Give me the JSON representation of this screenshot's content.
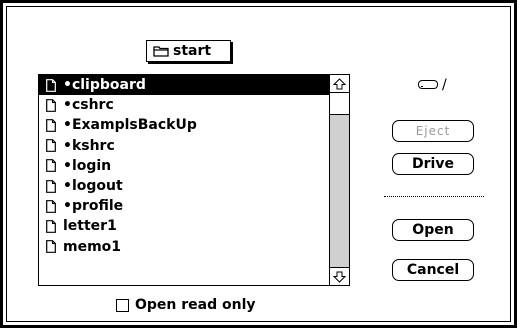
{
  "dialog": {
    "folder_popup": {
      "label": "start",
      "icon": "folder-icon"
    },
    "file_list": {
      "items": [
        {
          "label": "•clipboard",
          "icon": "document-icon",
          "selected": true
        },
        {
          "label": "•cshrc",
          "icon": "document-icon",
          "selected": false
        },
        {
          "label": "•ExamplsBackUp",
          "icon": "document-icon",
          "selected": false
        },
        {
          "label": "•kshrc",
          "icon": "document-icon",
          "selected": false
        },
        {
          "label": "•login",
          "icon": "document-icon",
          "selected": false
        },
        {
          "label": "•logout",
          "icon": "document-icon",
          "selected": false
        },
        {
          "label": "•profile",
          "icon": "document-icon",
          "selected": false
        },
        {
          "label": "letter1",
          "icon": "document-icon",
          "selected": false
        },
        {
          "label": "memo1",
          "icon": "document-icon",
          "selected": false
        }
      ]
    },
    "drive": {
      "label": "/",
      "icon": "hard-disk-icon"
    },
    "buttons": {
      "eject": "Eject",
      "drive": "Drive",
      "open": "Open",
      "cancel": "Cancel"
    },
    "open_read_only": {
      "label": "Open read only",
      "checked": false
    }
  }
}
